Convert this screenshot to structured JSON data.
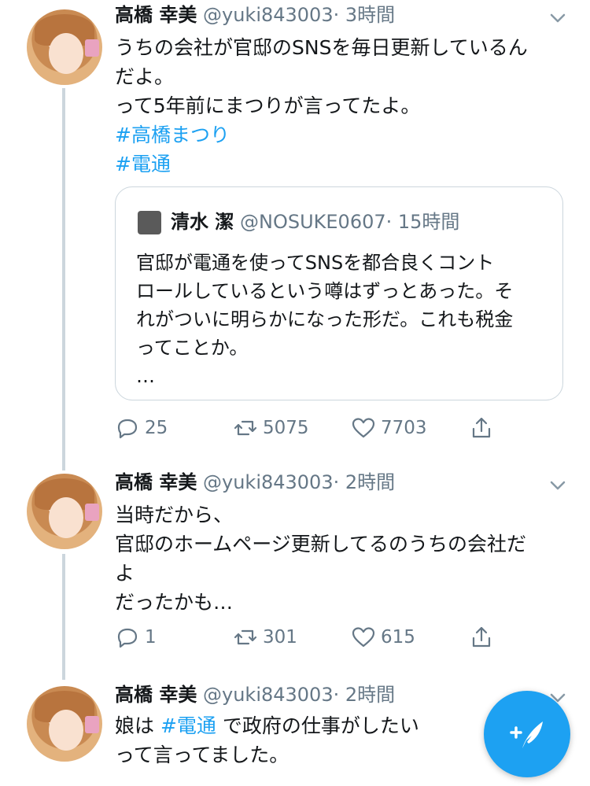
{
  "tweets": [
    {
      "name": "高橋 幸美",
      "handle": "@yuki843003",
      "time": "· 3時間",
      "lines": [
        "うちの会社が官邸のSNSを毎日更新しているん",
        "だよ。",
        "って5年前にまつりが言ってたよ。"
      ],
      "hashtags": [
        "#高橋まつり",
        "#電通"
      ],
      "replies": "25",
      "retweets": "5075",
      "likes": "7703"
    },
    {
      "name": "高橋 幸美",
      "handle": "@yuki843003",
      "time": "· 2時間",
      "lines": [
        "当時だから、",
        "官邸のホームページ更新してるのうちの会社だ",
        "よ",
        "だったかも…"
      ],
      "replies": "1",
      "retweets": "301",
      "likes": "615"
    },
    {
      "name": "高橋 幸美",
      "handle": "@yuki843003",
      "time": "· 2時間",
      "line1_before": "娘は ",
      "line1_tag": "#電通",
      "line1_after": " で政府の仕事がしたい",
      "line2": "って言ってました。"
    }
  ],
  "quote": {
    "name": "清水 潔",
    "handle": "@NOSUKE0607",
    "time": "· 15時間",
    "lines": [
      "官邸が電通を使ってSNSを都合良くコント",
      "ロールしているという噂はずっとあった。そ",
      "れがついに明らかになった形だ。これも税金",
      "ってことか。",
      "…"
    ]
  },
  "colors": {
    "accent": "#1da1f2",
    "text": "#14171a",
    "muted": "#657786",
    "border": "#ccd6dd"
  }
}
